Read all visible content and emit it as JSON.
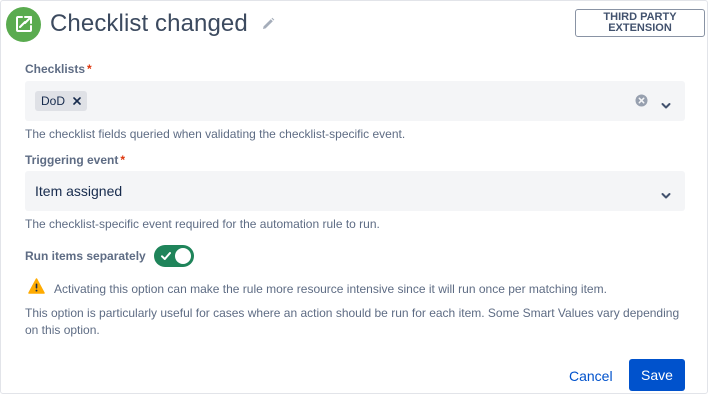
{
  "header": {
    "title": "Checklist changed",
    "badge_line1": "THIRD PARTY",
    "badge_line2": "EXTENSION"
  },
  "checklists": {
    "label": "Checklists",
    "required_mark": "*",
    "selected_chip": "DoD",
    "helper": "The checklist fields queried when validating the checklist-specific event."
  },
  "triggering_event": {
    "label": "Triggering event",
    "required_mark": "*",
    "value": "Item assigned",
    "helper": "The checklist-specific event required for the automation rule to run."
  },
  "run_items": {
    "label": "Run items separately",
    "enabled": true
  },
  "warning": {
    "text": "Activating this option can make the rule more resource intensive since it will run once per matching item."
  },
  "info": {
    "text": "This option is particularly useful for cases where an action should be run for each item. Some Smart Values vary depending on this option."
  },
  "footer": {
    "cancel_label": "Cancel",
    "save_label": "Save"
  },
  "colors": {
    "app_icon": "#5aab4f",
    "primary": "#0052cc",
    "toggle_on": "#1f845a",
    "required": "#de350b",
    "warning": "#ffab00"
  }
}
